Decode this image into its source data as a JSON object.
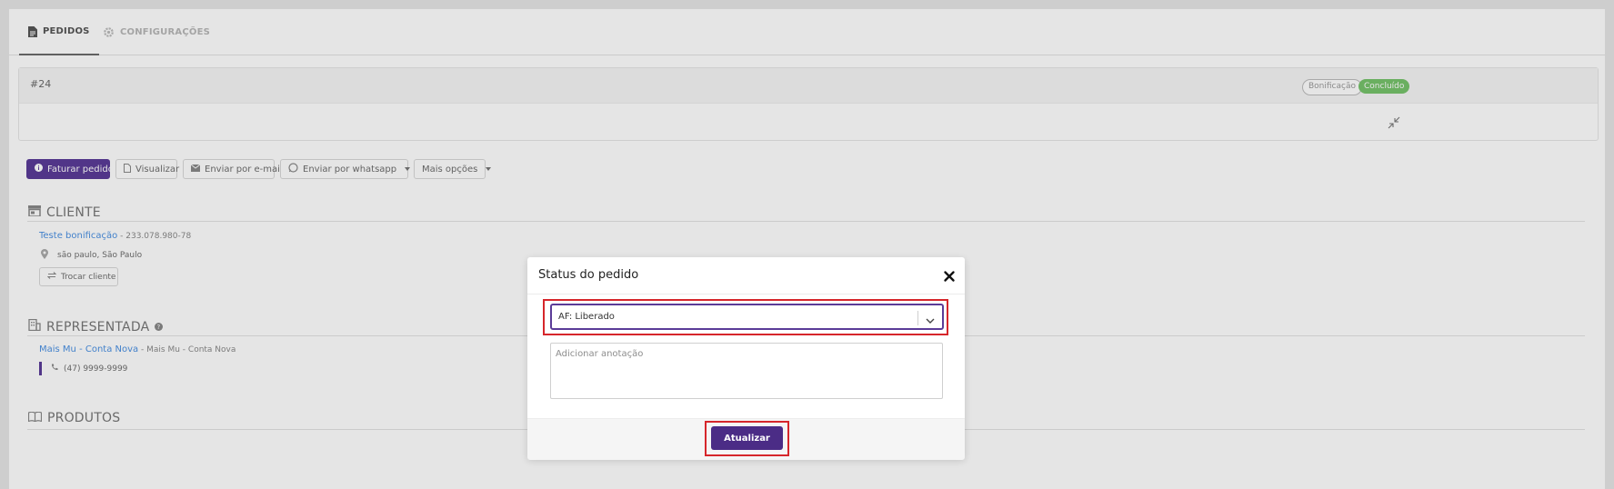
{
  "tabs": [
    {
      "label": "PEDIDOS",
      "icon": "document-icon",
      "active": true
    },
    {
      "label": "CONFIGURAÇÕES",
      "icon": "gear-icon",
      "active": false
    }
  ],
  "order": {
    "id": "#24",
    "badges": [
      "Bonificação",
      "Concluído"
    ]
  },
  "actions": {
    "invoice": "Faturar pedido",
    "view": "Visualizar",
    "email": "Enviar por e-mail",
    "whatsapp": "Enviar por whatsapp",
    "more": "Mais opções"
  },
  "client": {
    "section_title": "CLIENTE",
    "name": "Teste bonificação",
    "document": " - 233.078.980-78",
    "location": "são paulo, São Paulo",
    "change_button": "Trocar cliente"
  },
  "representative": {
    "section_title": "REPRESENTADA",
    "name": "Mais Mu - Conta Nova",
    "subtitle": " - Mais Mu - Conta Nova",
    "phone": "(47) 9999-9999"
  },
  "products": {
    "section_title": "PRODUTOS"
  },
  "modal": {
    "title": "Status do pedido",
    "selected_status": "AF: Liberado",
    "annotation_placeholder": "Adicionar anotação",
    "submit_label": "Atualizar"
  },
  "colors": {
    "primary": "#5b3c98",
    "submit": "#4b2c86",
    "highlight": "#d6262b",
    "status_done": "#77c36b",
    "link": "#4a90e2"
  }
}
